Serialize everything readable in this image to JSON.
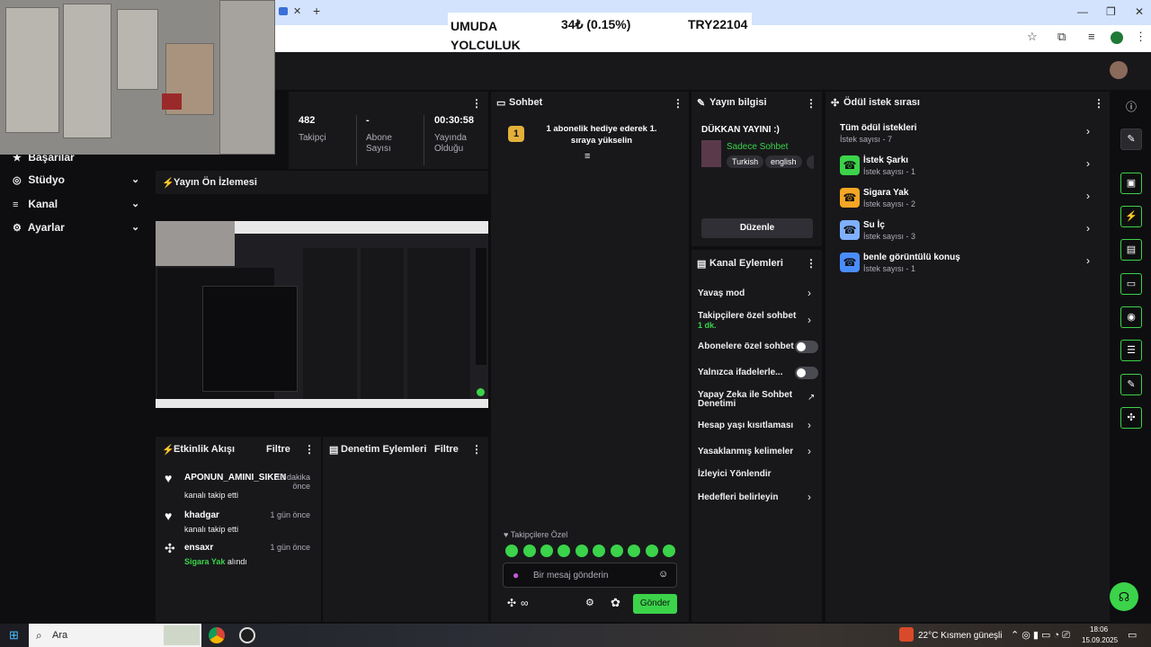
{
  "browser": {
    "tab_close": "✕",
    "tab_new": "+",
    "ticker": {
      "name": "UMUDA YOLCULUK",
      "change": "34₺ (0.15%)",
      "goal": "TRY22104"
    }
  },
  "nav": {
    "items": [
      {
        "label": "Başarılar"
      },
      {
        "label": "Stüdyo"
      },
      {
        "label": "Kanal"
      },
      {
        "label": "Ayarlar"
      }
    ]
  },
  "stats": [
    {
      "value": "482",
      "label": "Takipçi"
    },
    {
      "value": "-",
      "label": "Abone Sayısı"
    },
    {
      "value": "00:30:58",
      "label": "Yayında Olduğu"
    }
  ],
  "preview": {
    "title": "Yayın Ön İzlemesi"
  },
  "events": {
    "title": "Etkinlik Akışı",
    "filter": "Filtre",
    "items": [
      {
        "name": "APONUN_AMINI_SIKEN",
        "sub": "kanalı takip etti",
        "time": "19 dakika önce"
      },
      {
        "name": "khadgar",
        "sub": "kanalı takip etti",
        "time": "1 gün önce"
      },
      {
        "name": "ensaxr",
        "sub_highlight": "Sigara Yak",
        "sub": "alındı",
        "time": "1 gün önce"
      }
    ]
  },
  "moderation": {
    "title": "Denetim Eylemleri",
    "filter": "Filtre"
  },
  "chat": {
    "title": "Sohbet",
    "pinned": "1 abonelik hediye ederek 1. sıraya yükselin",
    "pinned_rank": "1",
    "followers_only": "Takipçilere Özel",
    "placeholder": "Bir mesaj gönderin",
    "send": "Gönder",
    "infinity": "∞"
  },
  "streaminfo": {
    "title": "Yayın bilgisi",
    "stream_title": "DÜKKAN YAYINI :)",
    "category": "Sadece Sohbet",
    "tags": [
      "Turkish",
      "english"
    ],
    "edit": "Düzenle"
  },
  "channel_actions": {
    "title": "Kanal Eylemleri",
    "items": [
      {
        "label": "Yavaş mod",
        "kind": "chevron"
      },
      {
        "label": "Takipçilere özel sohbet",
        "extra": "1 dk.",
        "kind": "chevron"
      },
      {
        "label": "Abonelere özel sohbet",
        "kind": "toggle"
      },
      {
        "label": "Yalnızca ifadelerle...",
        "kind": "toggle"
      },
      {
        "label": "Yapay Zeka ile Sohbet Denetimi",
        "kind": "external"
      },
      {
        "label": "Hesap yaşı kısıtlaması",
        "kind": "chevron"
      },
      {
        "label": "Yasaklanmış kelimeler",
        "kind": "chevron"
      },
      {
        "label": "İzleyici Yönlendir",
        "kind": "none"
      },
      {
        "label": "Hedefleri belirleyin",
        "kind": "chevron"
      }
    ]
  },
  "rewards": {
    "title": "Ödül istek sırası",
    "all": {
      "title": "Tüm ödül istekleri",
      "sub": "İstek sayısı - 7"
    },
    "items": [
      {
        "title": "İstek Şarkı",
        "sub": "İstek sayısı - 1",
        "color": "#3bd34a"
      },
      {
        "title": "Sigara Yak",
        "sub": "İstek sayısı - 2",
        "color": "#f5a623"
      },
      {
        "title": "Su İç",
        "sub": "İstek sayısı - 3",
        "color": "#7fb0ff"
      },
      {
        "title": "benle görüntülü konuş",
        "sub": "İstek sayısı - 1",
        "color": "#4a8cff"
      }
    ]
  },
  "taskbar": {
    "search": "Ara",
    "weather": "22°C  Kısmen güneşli",
    "time": "18:06",
    "date": "15.09.2025"
  },
  "colors": {
    "accent": "#3bd34a",
    "panel": "#18181b",
    "bg": "#0e0e10"
  }
}
